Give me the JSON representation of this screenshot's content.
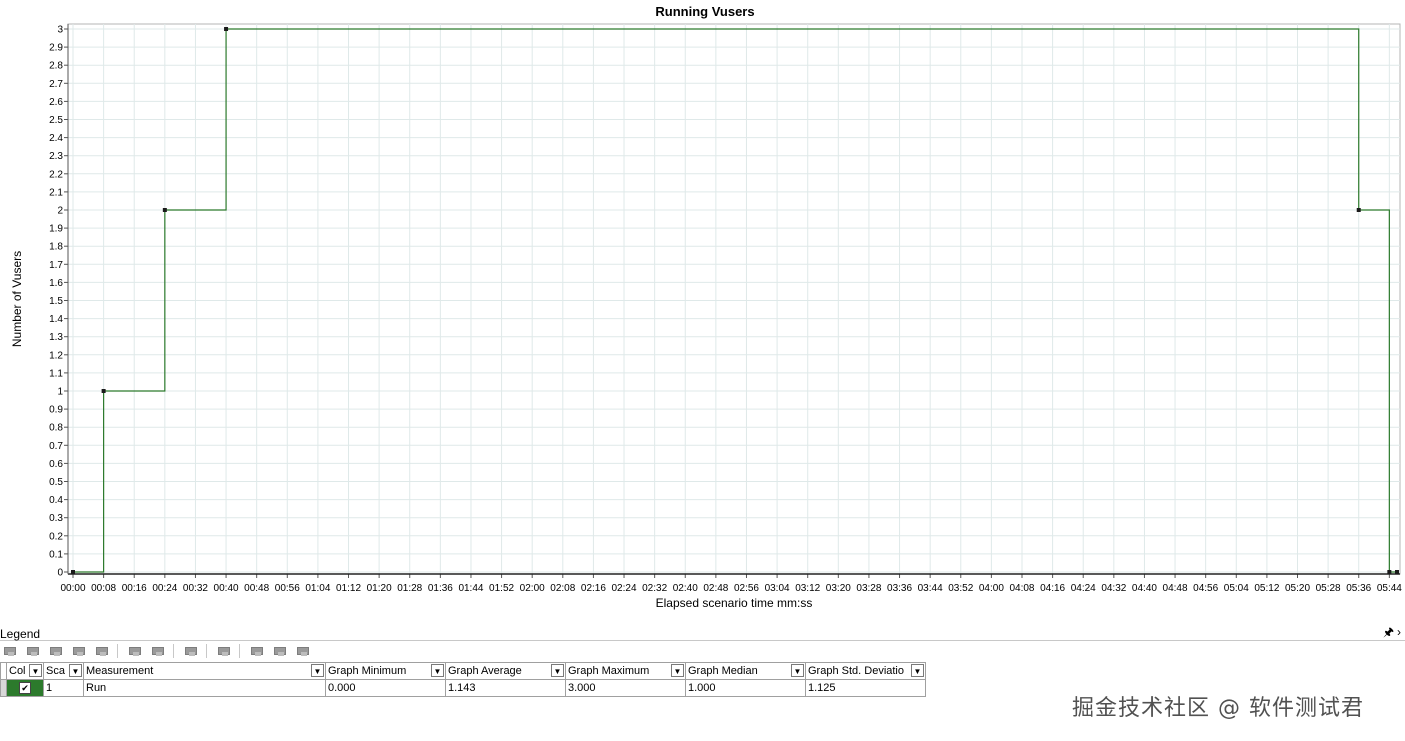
{
  "chart_data": {
    "type": "line",
    "title": "Running Vusers",
    "xlabel": "Elapsed scenario time mm:ss",
    "ylabel": "Number of Vusers",
    "ylim": [
      0,
      3
    ],
    "xlim": [
      0,
      346
    ],
    "y_ticks": [
      "0",
      "0.1",
      "0.2",
      "0.3",
      "0.4",
      "0.5",
      "0.6",
      "0.7",
      "0.8",
      "0.9",
      "1",
      "1.1",
      "1.2",
      "1.3",
      "1.4",
      "1.5",
      "1.6",
      "1.7",
      "1.8",
      "1.9",
      "2",
      "2.1",
      "2.2",
      "2.3",
      "2.4",
      "2.5",
      "2.6",
      "2.7",
      "2.8",
      "2.9",
      "3"
    ],
    "x_ticks": [
      "00:00",
      "00:08",
      "00:16",
      "00:24",
      "00:32",
      "00:40",
      "00:48",
      "00:56",
      "01:04",
      "01:12",
      "01:20",
      "01:28",
      "01:36",
      "01:44",
      "01:52",
      "02:00",
      "02:08",
      "02:16",
      "02:24",
      "02:32",
      "02:40",
      "02:48",
      "02:56",
      "03:04",
      "03:12",
      "03:20",
      "03:28",
      "03:36",
      "03:44",
      "03:52",
      "04:00",
      "04:08",
      "04:16",
      "04:24",
      "04:32",
      "04:40",
      "04:48",
      "04:56",
      "05:04",
      "05:12",
      "05:20",
      "05:28",
      "05:36",
      "05:44"
    ],
    "grid": true,
    "series": [
      {
        "name": "Run",
        "color": "#2c7a2c",
        "step": true,
        "points": [
          [
            0,
            0
          ],
          [
            8,
            1
          ],
          [
            24,
            2
          ],
          [
            40,
            3
          ],
          [
            336,
            2
          ],
          [
            344,
            0
          ],
          [
            346,
            0
          ]
        ]
      }
    ]
  },
  "legend": {
    "title": "Legend",
    "pin_icon": "pin-icon",
    "close_icon": "close-icon",
    "columns": [
      "Col",
      "Sca",
      "Measurement",
      "Graph Minimum",
      "Graph Average",
      "Graph Maximum",
      "Graph Median",
      "Graph Std. Deviatio"
    ],
    "rows": [
      {
        "checked": true,
        "color": "#2c7a2c",
        "scale": "1",
        "measurement": "Run",
        "min": "0.000",
        "avg": "1.143",
        "max": "3.000",
        "median": "1.000",
        "std": "1.125"
      }
    ]
  },
  "watermark": "掘金技术社区 @ 软件测试君"
}
